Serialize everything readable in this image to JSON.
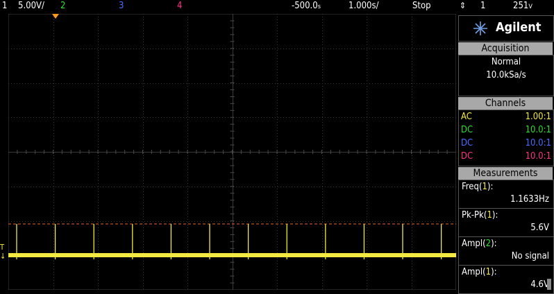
{
  "topbar": {
    "ch1_num": "1",
    "ch1_scale": "5.00V/",
    "ch2_num": "2",
    "ch3_num": "3",
    "ch4_num": "4",
    "time_offset": "-500.0",
    "time_offset_unit": "s",
    "time_scale": "1.000s/",
    "run_state": "Stop",
    "trigger_symbol": "↑",
    "trigger_channel": "1",
    "trigger_level": "251",
    "trigger_level_unit": "V"
  },
  "brand": "Agilent",
  "acquisition": {
    "title": "Acquisition",
    "mode": "Normal",
    "rate": "10.0kSa/s"
  },
  "channels": {
    "title": "Channels",
    "rows": [
      {
        "coupling": "AC",
        "probe": "1.00:1",
        "color": "#f4e940"
      },
      {
        "coupling": "DC",
        "probe": "10.0:1",
        "color": "#2ddc2d"
      },
      {
        "coupling": "DC",
        "probe": "10.0:1",
        "color": "#4b6bff"
      },
      {
        "coupling": "DC",
        "probe": "10.0:1",
        "color": "#ff3385"
      }
    ]
  },
  "measurements": {
    "title": "Measurements",
    "items": [
      {
        "name": "Freq",
        "ch": "1",
        "value": "1.1633Hz"
      },
      {
        "name": "Pk-Pk",
        "ch": "1",
        "value": "5.6V"
      },
      {
        "name": "Ampl",
        "ch": "2",
        "value": "No signal"
      },
      {
        "name": "Ampl",
        "ch": "1",
        "value": "4.6V"
      }
    ]
  },
  "colors": {
    "ch1": "#f4e940",
    "ch2": "#2ddc2d",
    "ch3": "#4b6bff",
    "ch4": "#ff3385",
    "trigger_marker": "#ff9a1a",
    "grid": "#3a3a3a"
  }
}
